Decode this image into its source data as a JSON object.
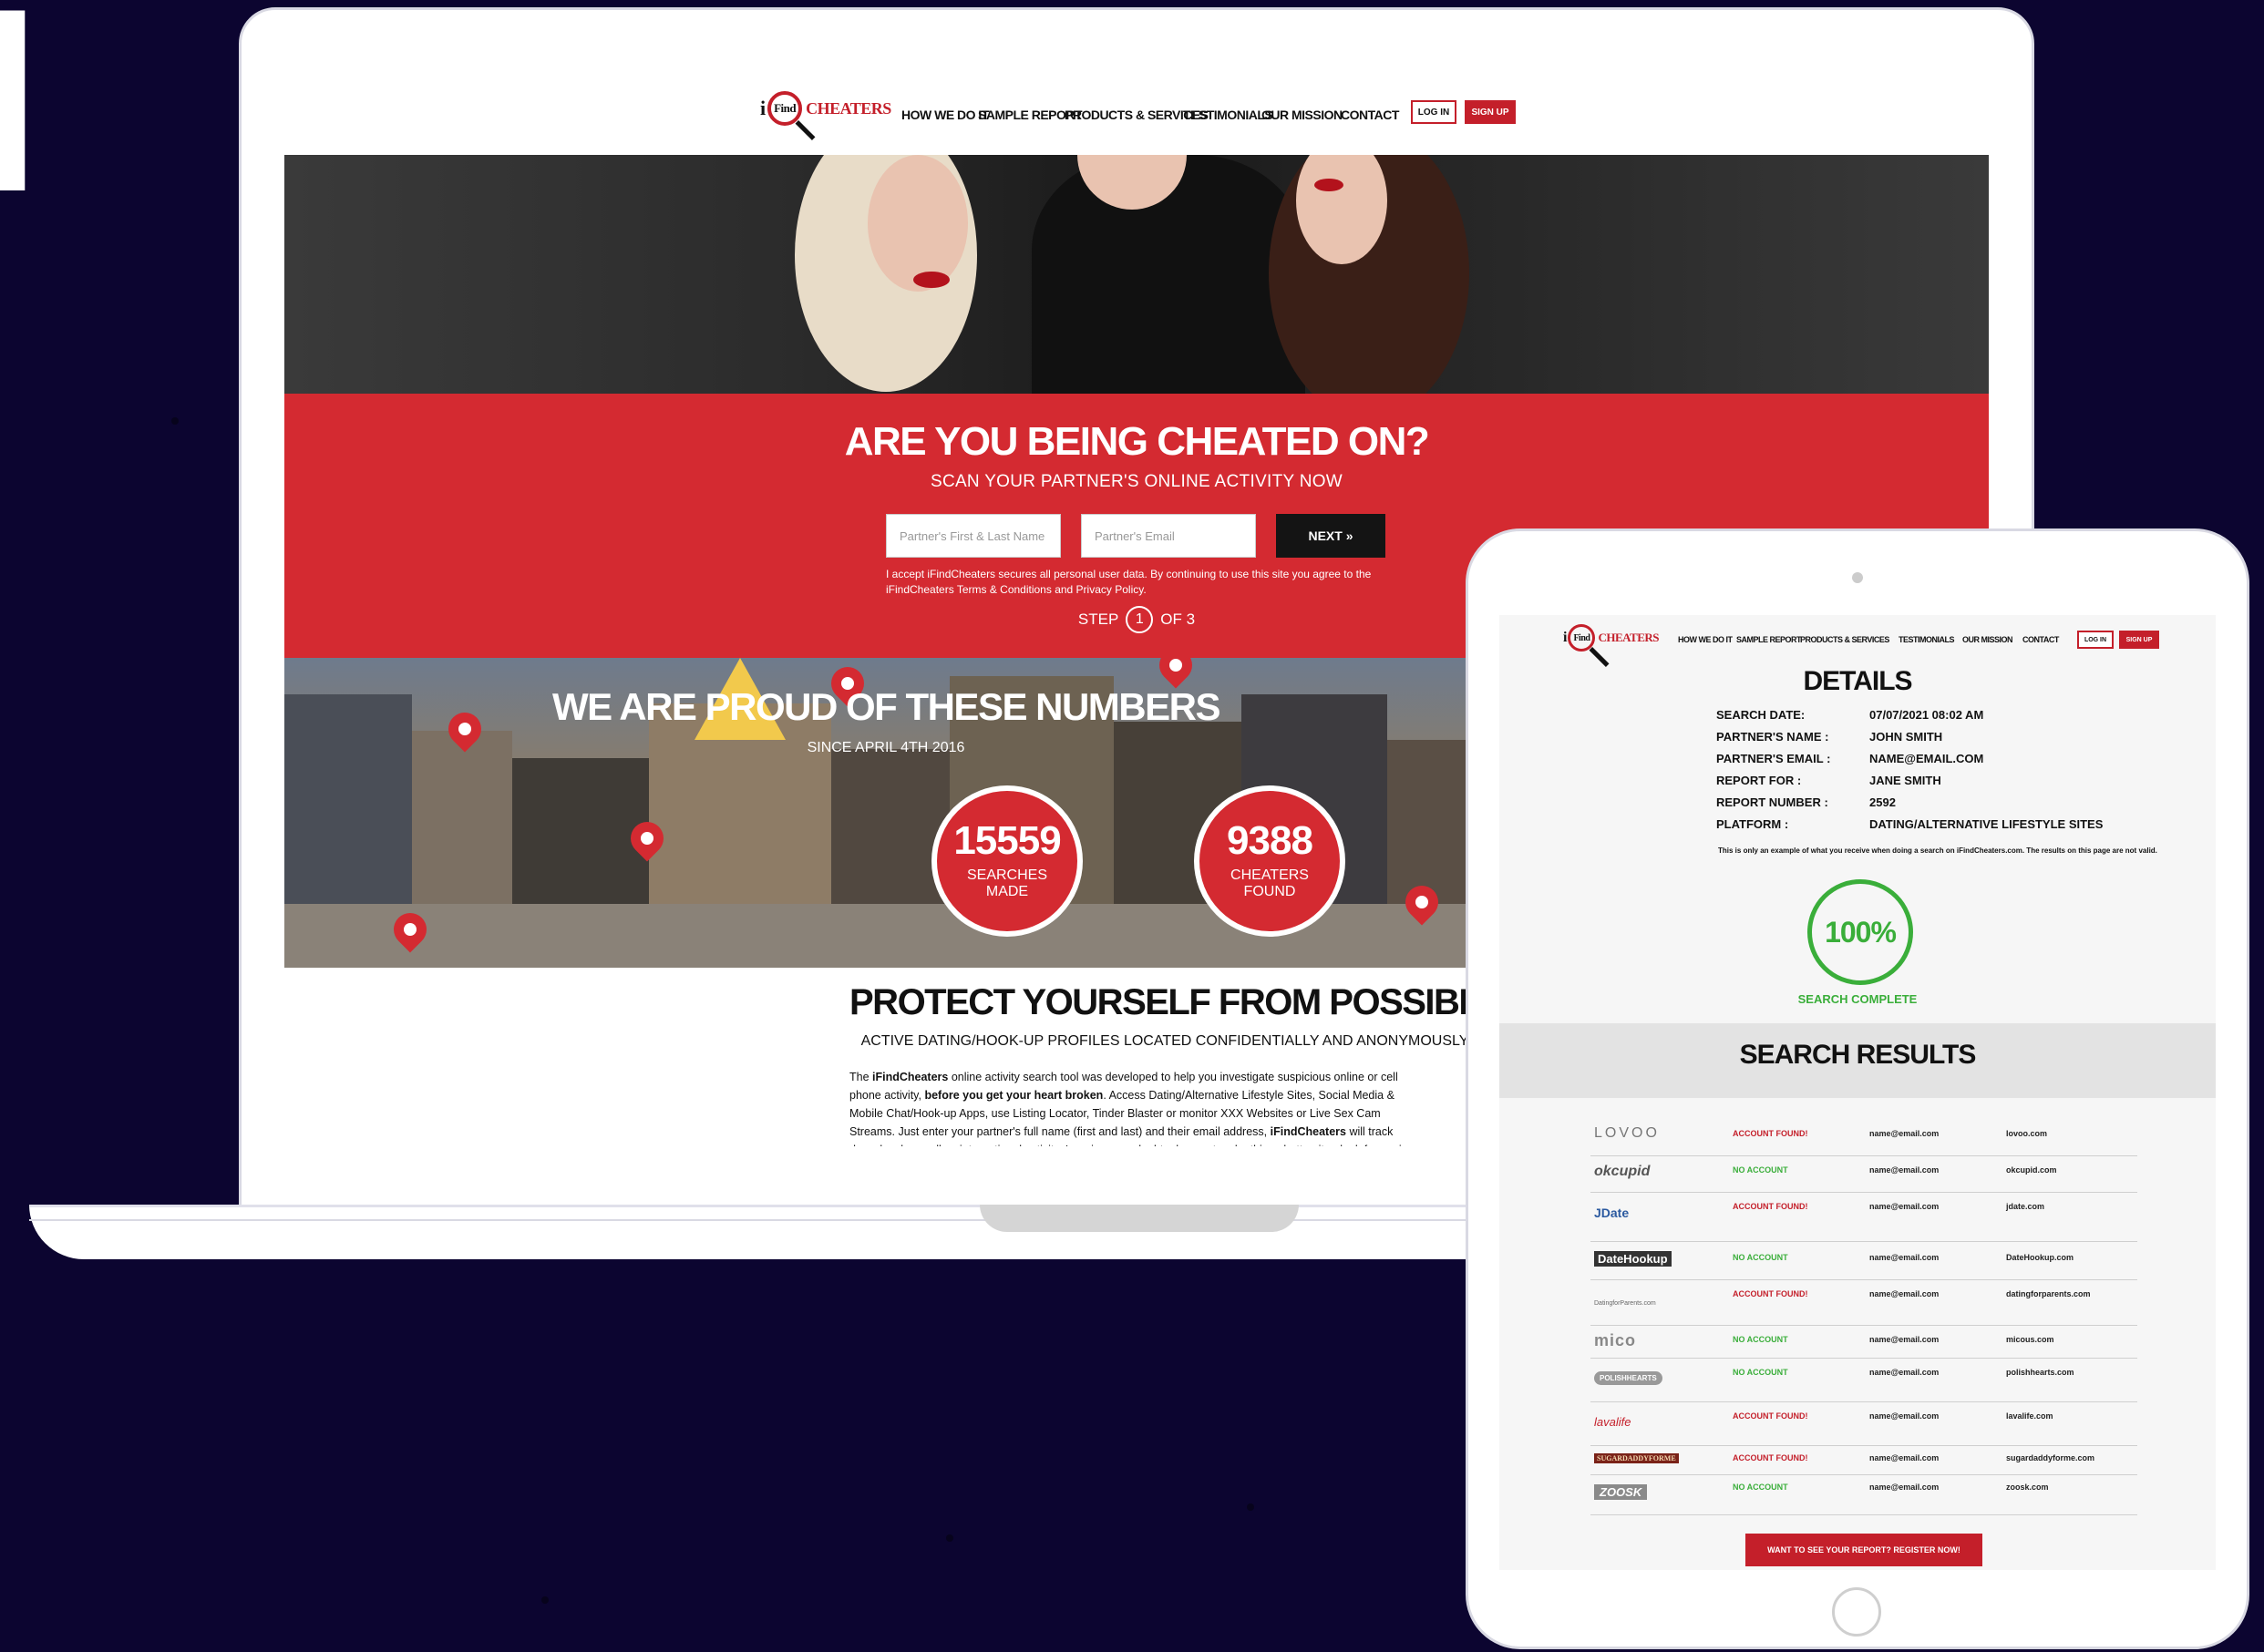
{
  "background_glyph": "l",
  "colors": {
    "brand_red": "#d42a31",
    "found_red": "#c41f2a",
    "success_green": "#3aae3a",
    "page_bg": "#0c0530"
  },
  "desktop": {
    "logo": {
      "prefix": "i",
      "ring": "Find",
      "suffix": "CHEATERS"
    },
    "nav": [
      "HOW WE DO IT",
      "SAMPLE REPORT",
      "PRODUCTS & SERVICES",
      "TESTIMONIALS",
      "OUR MISSION",
      "CONTACT"
    ],
    "login": "LOG IN",
    "signup": "SIGN UP",
    "hero": {
      "title": "ARE YOU BEING CHEATED ON?",
      "subtitle": "SCAN YOUR PARTNER'S ONLINE ACTIVITY NOW",
      "name_placeholder": "Partner's First & Last Name",
      "email_placeholder": "Partner's Email",
      "next": "NEXT »",
      "consent": "I accept iFindCheaters secures all personal user data. By continuing to use this site you agree to the iFindCheaters Terms & Conditions and Privacy Policy.",
      "step_prefix": "STEP",
      "step_number": "1",
      "step_suffix": "OF 3"
    },
    "numbers": {
      "title": "WE ARE PROUD OF THESE NUMBERS",
      "subtitle": "SINCE APRIL 4TH 2016",
      "searches_value": "15559",
      "searches_label_1": "SEARCHES",
      "searches_label_2": "MADE",
      "cheaters_value": "9388",
      "cheaters_label_1": "CHEATERS",
      "cheaters_label_2": "FOUND"
    },
    "protect": {
      "title": "PROTECT YOURSELF FROM POSSIBLE CHEATERS",
      "subtitle": "ACTIVE DATING/HOOK-UP PROFILES LOCATED CONFIDENTIALLY AND ANONYMOUSLY",
      "body_1": "The ",
      "body_brand": "iFindCheaters",
      "body_2": " online activity search tool was developed to help you investigate suspicious online or cell phone activity, ",
      "body_bold": "before you get your heart broken",
      "body_3": ". Access Dating/Alternative Lifestyle Sites, Social Media & Mobile Chat/Hook-up Apps, use Listing Locator, Tinder Blaster or monitor XXX Websites or Live Sex Cam Streams. Just enter your partner's full name (first and last) and their email address, ",
      "body_brand_2": "iFindCheaters",
      "body_4": " will track down local as well as international activity. Ignoring your doubts does not make things better, it only defers pain."
    }
  },
  "tablet": {
    "details_title": "DETAILS",
    "details": [
      {
        "label": "SEARCH DATE:",
        "value": "07/07/2021 08:02 AM"
      },
      {
        "label": "PARTNER'S NAME :",
        "value": "JOHN SMITH"
      },
      {
        "label": "PARTNER'S EMAIL :",
        "value": "NAME@EMAIL.COM"
      },
      {
        "label": "REPORT FOR :",
        "value": "JANE SMITH"
      },
      {
        "label": "REPORT NUMBER :",
        "value": "2592"
      },
      {
        "label": "PLATFORM :",
        "value": "DATING/ALTERNATIVE LIFESTYLE SITES"
      }
    ],
    "disclaimer": "This is only an example of what you receive when doing a search on iFindCheaters.com. The results on this page are not valid.",
    "progress": "100%",
    "progress_value": 100,
    "search_complete": "SEARCH COMPLETE",
    "results_title": "SEARCH RESULTS",
    "results": [
      {
        "logo": "LOVOO",
        "status": "ACCOUNT FOUND!",
        "found": true,
        "email": "name@email.com",
        "site": "lovoo.com"
      },
      {
        "logo": "okcupid",
        "status": "NO ACCOUNT",
        "found": false,
        "email": "name@email.com",
        "site": "okcupid.com"
      },
      {
        "logo": "JDate",
        "status": "ACCOUNT FOUND!",
        "found": true,
        "email": "name@email.com",
        "site": "jdate.com"
      },
      {
        "logo": "DateHookup",
        "status": "NO ACCOUNT",
        "found": false,
        "email": "name@email.com",
        "site": "DateHookup.com"
      },
      {
        "logo": "DatingforParents.com",
        "status": "ACCOUNT FOUND!",
        "found": true,
        "email": "name@email.com",
        "site": "datingforparents.com"
      },
      {
        "logo": "mico",
        "status": "NO ACCOUNT",
        "found": false,
        "email": "name@email.com",
        "site": "micous.com"
      },
      {
        "logo": "POLISHHEARTS",
        "status": "NO ACCOUNT",
        "found": false,
        "email": "name@email.com",
        "site": "polishhearts.com"
      },
      {
        "logo": "lavalife",
        "status": "ACCOUNT FOUND!",
        "found": true,
        "email": "name@email.com",
        "site": "lavalife.com"
      },
      {
        "logo": "SUGARDADDYFORME",
        "status": "ACCOUNT FOUND!",
        "found": true,
        "email": "name@email.com",
        "site": "sugardaddyforme.com"
      },
      {
        "logo": "ZOOSK",
        "status": "NO ACCOUNT",
        "found": false,
        "email": "name@email.com",
        "site": "zoosk.com"
      }
    ],
    "cta": "WANT TO SEE YOUR REPORT? REGISTER NOW!"
  }
}
